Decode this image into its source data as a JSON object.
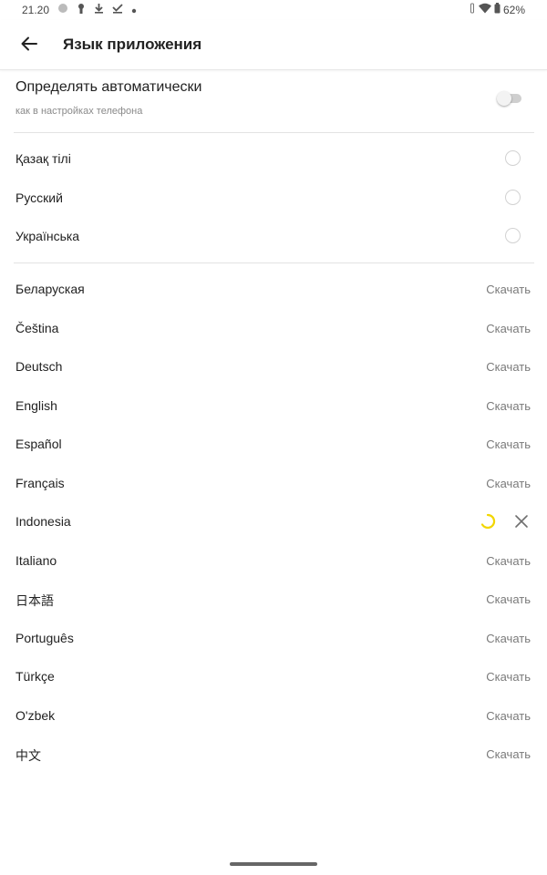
{
  "status_bar": {
    "time": "21.20",
    "battery": "62%",
    "left_icons": [
      "notification-icon",
      "lock-icon",
      "download-icon",
      "check-icon",
      "dot-icon"
    ],
    "right_icons": [
      "vibrate-icon",
      "wifi-icon",
      "battery-icon"
    ]
  },
  "header": {
    "title": "Язык приложения",
    "back_icon": "arrow-left-icon"
  },
  "auto_detect": {
    "title": "Определять автоматически",
    "subtitle": "как в настройках телефона",
    "enabled": false
  },
  "installed_languages": [
    {
      "label": "Қазақ тілі",
      "selected": false
    },
    {
      "label": "Русский",
      "selected": false
    },
    {
      "label": "Українська",
      "selected": false
    }
  ],
  "download_label": "Скачать",
  "downloadable_languages": [
    {
      "label": "Беларуская",
      "state": "download"
    },
    {
      "label": "Čeština",
      "state": "download"
    },
    {
      "label": "Deutsch",
      "state": "download"
    },
    {
      "label": "English",
      "state": "download"
    },
    {
      "label": "Español",
      "state": "download"
    },
    {
      "label": "Français",
      "state": "download"
    },
    {
      "label": "Indonesia",
      "state": "loading"
    },
    {
      "label": "Italiano",
      "state": "download"
    },
    {
      "label": "日本語",
      "state": "download"
    },
    {
      "label": "Português",
      "state": "download"
    },
    {
      "label": "Türkçe",
      "state": "download"
    },
    {
      "label": "O'zbek",
      "state": "download"
    },
    {
      "label": "中文",
      "state": "download"
    }
  ],
  "colors": {
    "accent": "#f2d600",
    "text": "#222222",
    "secondary": "#7a7a7a",
    "divider": "#e3e3e3"
  }
}
